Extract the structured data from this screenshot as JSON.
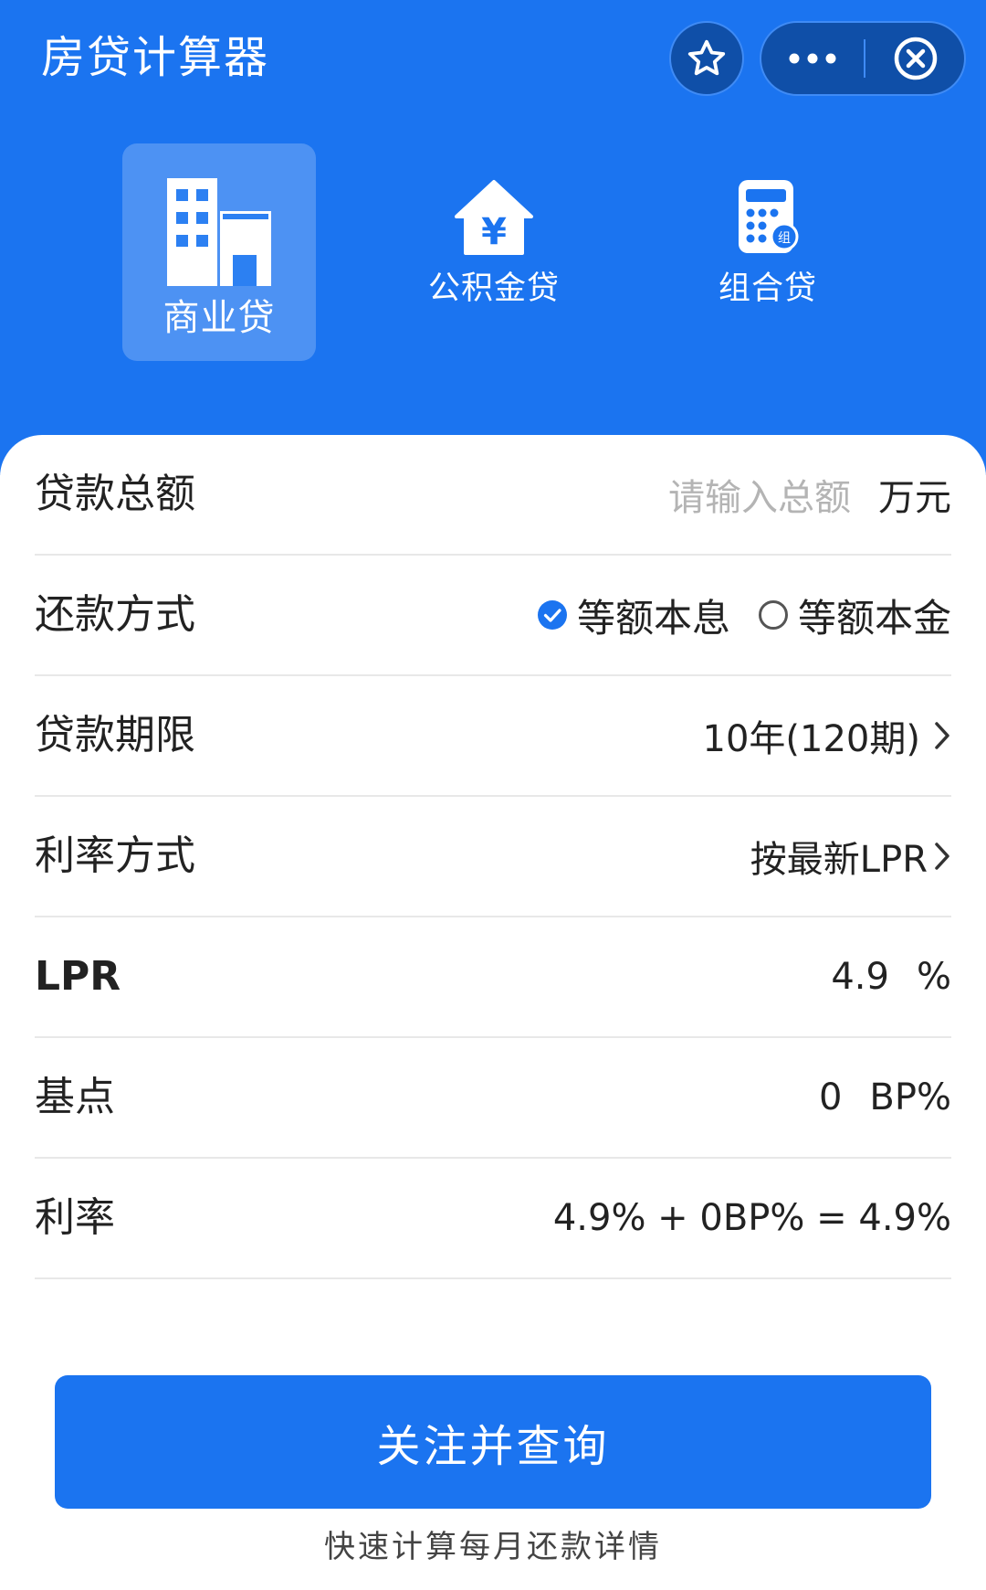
{
  "header": {
    "title": "房贷计算器",
    "accent_color": "#1b74f0",
    "capsule_icons": [
      "star-icon",
      "more-icon",
      "close-circle-icon"
    ]
  },
  "tabs": [
    {
      "label": "商业贷",
      "icon": "building-icon",
      "active": true
    },
    {
      "label": "公积金贷",
      "icon": "house-yen-icon",
      "active": false
    },
    {
      "label": "组合贷",
      "icon": "calculator-icon",
      "active": false,
      "badge": "组"
    }
  ],
  "form": {
    "loan_amount": {
      "label": "贷款总额",
      "placeholder": "请输入总额",
      "value": "",
      "unit": "万元"
    },
    "repayment": {
      "label": "还款方式",
      "options": [
        "等额本息",
        "等额本金"
      ],
      "selected": "等额本息"
    },
    "term": {
      "label": "贷款期限",
      "value": "10年(120期)"
    },
    "rate_mode": {
      "label": "利率方式",
      "value": "按最新LPR"
    },
    "lpr": {
      "label": "LPR",
      "value": "4.9",
      "unit": "%"
    },
    "basis_points": {
      "label": "基点",
      "value": "0",
      "unit": "BP%"
    },
    "rate": {
      "label": "利率",
      "value": "4.9% + 0BP% = 4.9%"
    }
  },
  "action": {
    "submit_label": "关注并查询",
    "footnote": "快速计算每月还款详情"
  }
}
